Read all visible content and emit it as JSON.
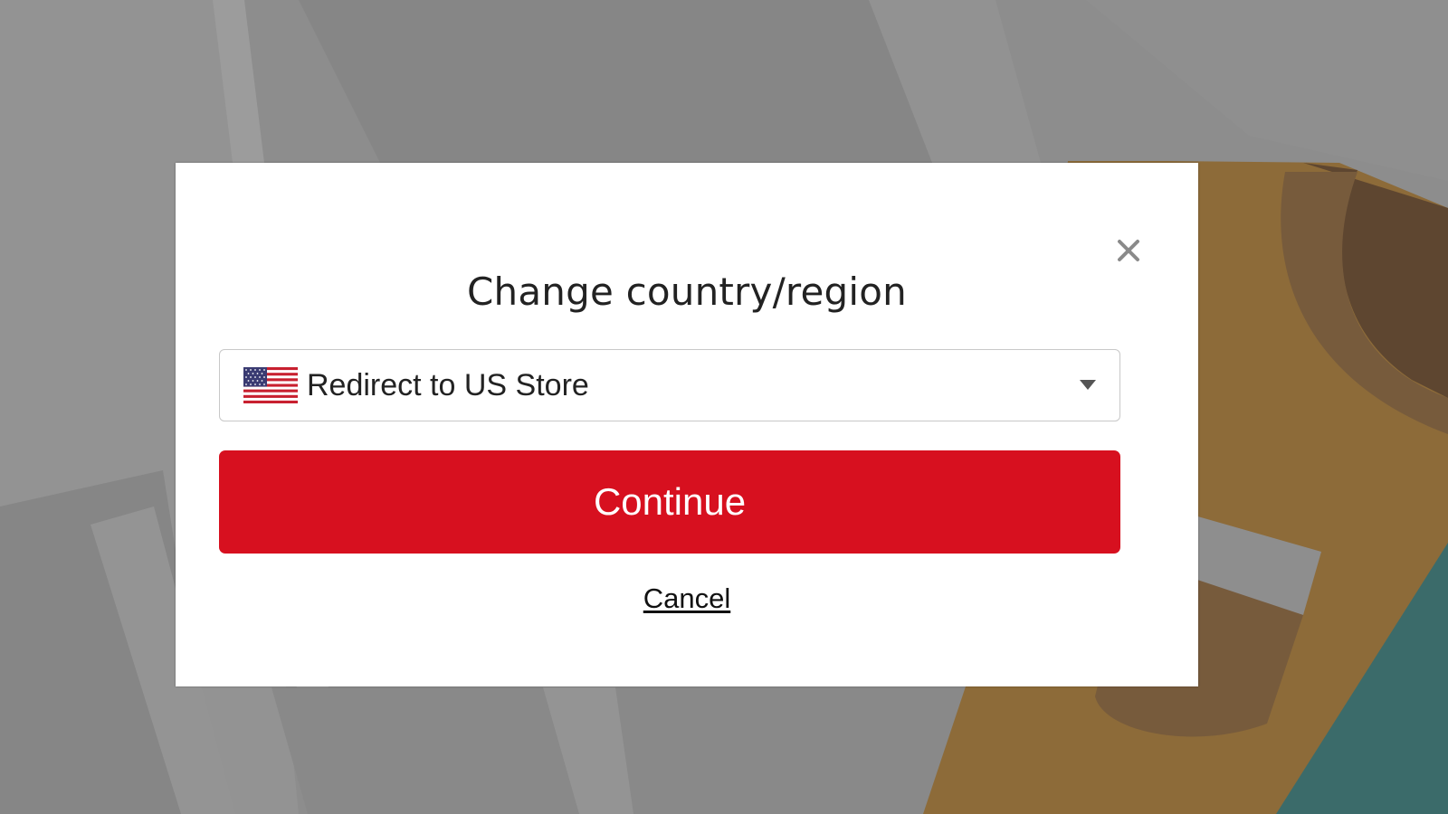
{
  "dialog": {
    "title": "Change country/region",
    "close_icon": "close-icon",
    "country_select": {
      "flag_icon": "us-flag-icon",
      "value": "Redirect to US Store",
      "caret_icon": "chevron-down-icon"
    },
    "continue_label": "Continue",
    "cancel_label": "Cancel"
  },
  "colors": {
    "primary_button": "#d7101f",
    "overlay": "#8c8c8c"
  }
}
